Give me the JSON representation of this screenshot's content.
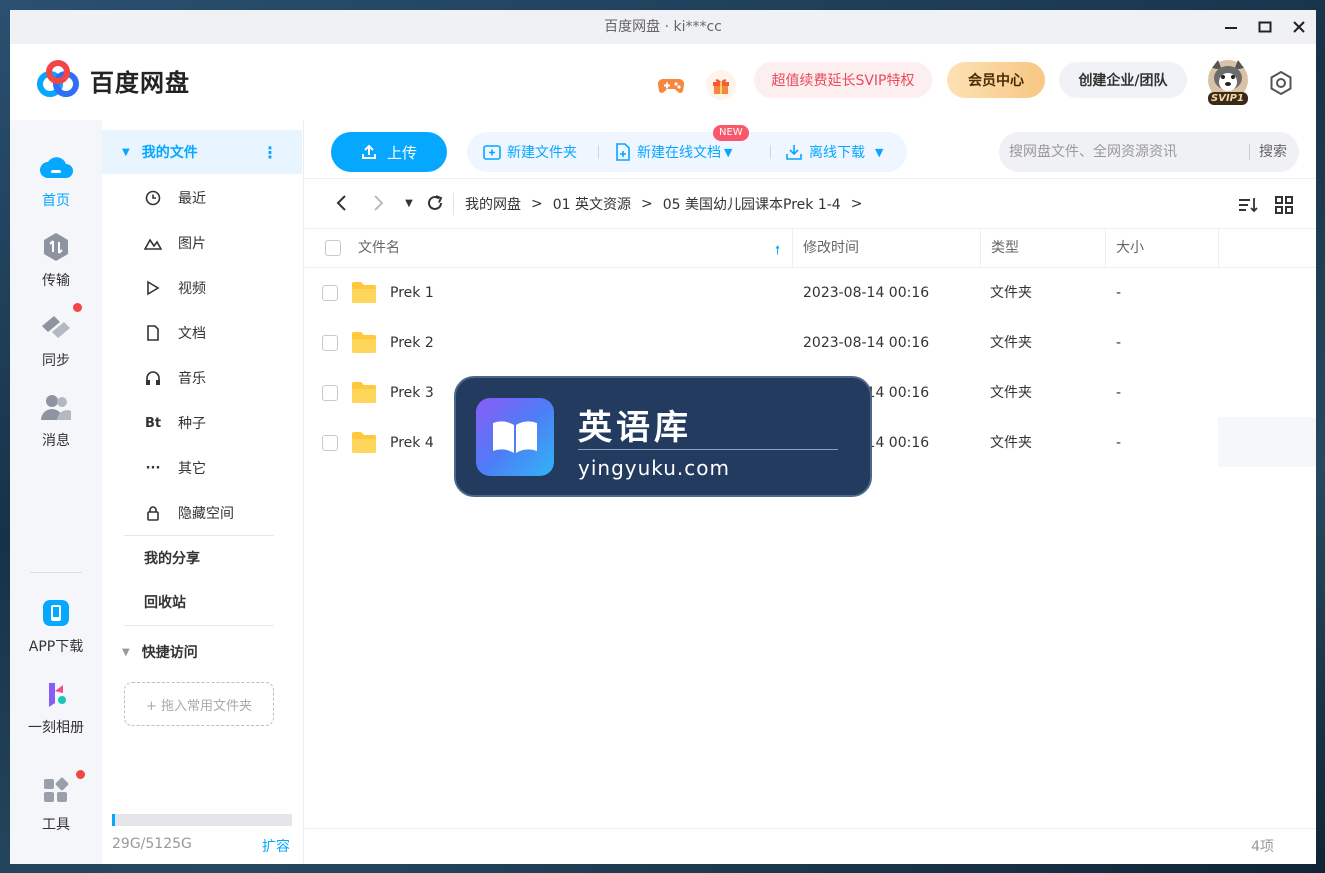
{
  "window": {
    "title": "百度网盘 · ki***cc",
    "controls": {
      "minimize": "—",
      "maximize": "☐",
      "close": "✕"
    }
  },
  "header": {
    "logo_text": "百度网盘",
    "game_icon": "gamepad-icon",
    "gift_icon": "gift-icon",
    "svip_promo": "超值续费延长SVIP特权",
    "vip_center": "会员中心",
    "create_team": "创建企业/团队",
    "avatar_badge": "SVIP1"
  },
  "leftnav": {
    "items": [
      {
        "label": "首页",
        "icon": "cloud-icon"
      },
      {
        "label": "传输",
        "icon": "transfer-icon"
      },
      {
        "label": "同步",
        "icon": "sync-icon"
      },
      {
        "label": "消息",
        "icon": "message-icon"
      },
      {
        "label": "APP下载",
        "icon": "app-download-icon"
      },
      {
        "label": "一刻相册",
        "icon": "album-icon"
      },
      {
        "label": "工具",
        "icon": "tools-icon"
      }
    ]
  },
  "sidebar": {
    "my_files": "我的文件",
    "items": [
      {
        "label": "最近",
        "icon": "clock-icon"
      },
      {
        "label": "图片",
        "icon": "image-icon"
      },
      {
        "label": "视频",
        "icon": "play-icon"
      },
      {
        "label": "文档",
        "icon": "document-icon"
      },
      {
        "label": "音乐",
        "icon": "headphones-icon"
      },
      {
        "label": "种子",
        "icon": "torrent-icon"
      },
      {
        "label": "其它",
        "icon": "more-icon"
      },
      {
        "label": "隐藏空间",
        "icon": "lock-icon"
      }
    ],
    "torrent_glyph": "Bt",
    "my_share": "我的分享",
    "recycle_bin": "回收站",
    "quick_access": "快捷访问",
    "drop_hint": "+ 拖入常用文件夹",
    "quota": "29G/5125G",
    "quota_used_fraction": 0.0057,
    "expand": "扩容"
  },
  "toolbar": {
    "upload": "上传",
    "new_folder": "新建文件夹",
    "new_online_doc": "新建在线文档",
    "new_badge": "NEW",
    "offline_download": "离线下载",
    "search_placeholder": "搜网盘文件、全网资源资讯",
    "search_button": "搜索"
  },
  "breadcrumb": [
    "我的网盘",
    "01 英文资源",
    "05 美国幼儿园课本Prek 1-4"
  ],
  "table": {
    "headers": {
      "name": "文件名",
      "modified": "修改时间",
      "type": "类型",
      "size": "大小"
    },
    "rows": [
      {
        "name": "Prek 1",
        "modified": "2023-08-14 00:16",
        "type": "文件夹",
        "size": "-"
      },
      {
        "name": "Prek 2",
        "modified": "2023-08-14 00:16",
        "type": "文件夹",
        "size": "-"
      },
      {
        "name": "Prek 3",
        "modified": "2023-08-14 00:16",
        "type": "文件夹",
        "size": "-"
      },
      {
        "name": "Prek 4",
        "modified": "2023-08-14 00:16",
        "type": "文件夹",
        "size": "-"
      }
    ]
  },
  "overlay": {
    "title": "英语库",
    "subtitle": "yingyuku.com"
  },
  "footer": {
    "count": "4项"
  },
  "colors": {
    "accent": "#06a7ff",
    "danger": "#f04646",
    "vip_gold": "#f7c683"
  }
}
